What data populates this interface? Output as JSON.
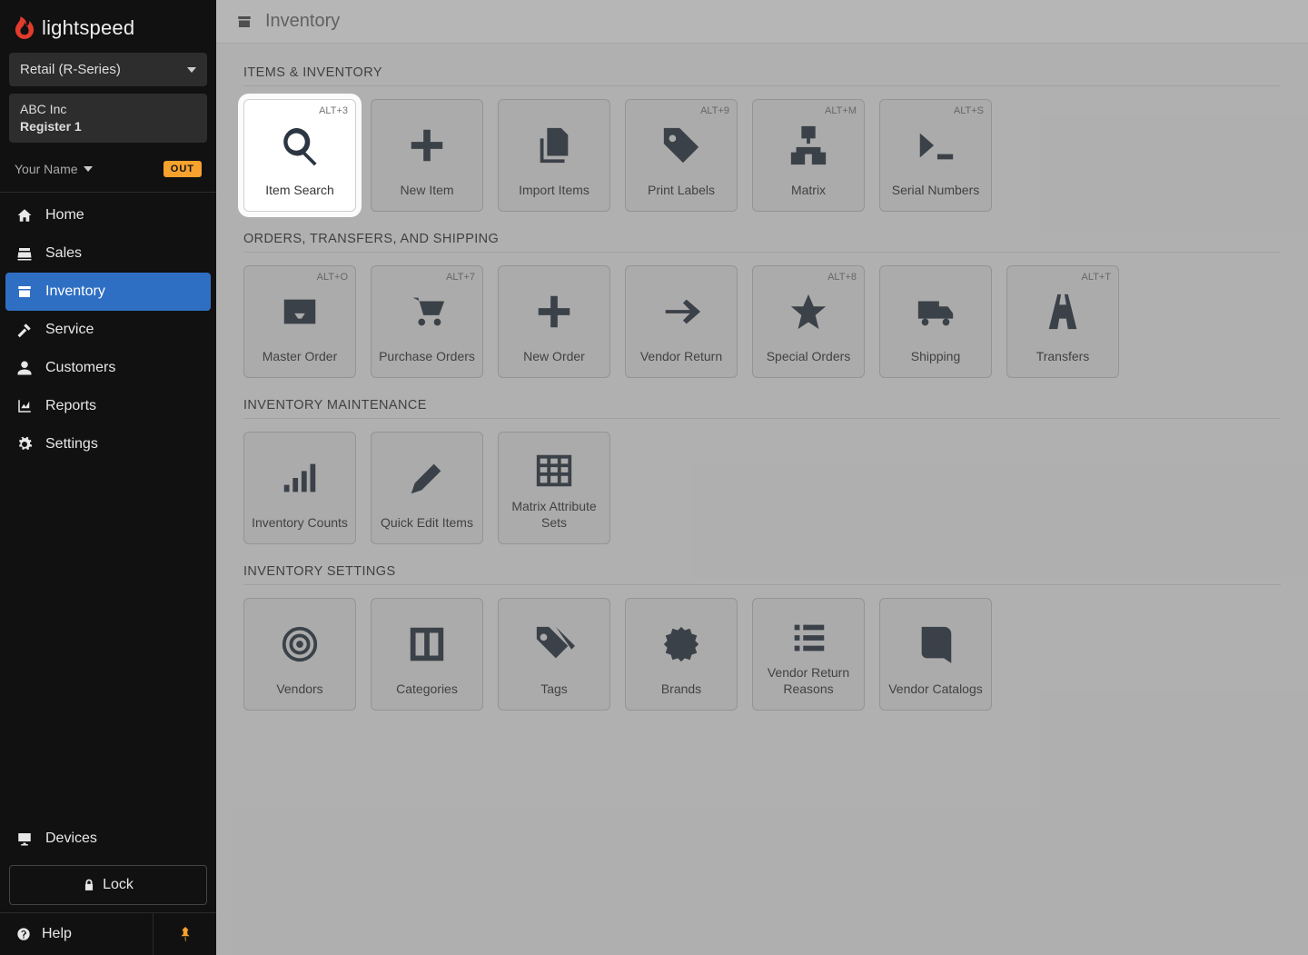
{
  "brand": "lightspeed",
  "selector": {
    "label": "Retail (R-Series)"
  },
  "store": {
    "name": "ABC Inc",
    "register": "Register 1"
  },
  "user": {
    "name": "Your Name",
    "badge": "OUT"
  },
  "nav": {
    "home": "Home",
    "sales": "Sales",
    "inventory": "Inventory",
    "service": "Service",
    "customers": "Customers",
    "reports": "Reports",
    "settings": "Settings",
    "devices": "Devices",
    "lock": "Lock",
    "help": "Help"
  },
  "page": {
    "title": "Inventory"
  },
  "sections": {
    "items": {
      "title": "ITEMS & INVENTORY",
      "cards": {
        "item_search": {
          "label": "Item Search",
          "shortcut": "ALT+3"
        },
        "new_item": {
          "label": "New Item",
          "shortcut": ""
        },
        "import_items": {
          "label": "Import Items",
          "shortcut": ""
        },
        "print_labels": {
          "label": "Print Labels",
          "shortcut": "ALT+9"
        },
        "matrix": {
          "label": "Matrix",
          "shortcut": "ALT+M"
        },
        "serial_numbers": {
          "label": "Serial Numbers",
          "shortcut": "ALT+S"
        }
      }
    },
    "orders": {
      "title": "ORDERS, TRANSFERS, AND SHIPPING",
      "cards": {
        "master_order": {
          "label": "Master Order",
          "shortcut": "ALT+O"
        },
        "purchase_orders": {
          "label": "Purchase Orders",
          "shortcut": "ALT+7"
        },
        "new_order": {
          "label": "New Order",
          "shortcut": ""
        },
        "vendor_return": {
          "label": "Vendor Return",
          "shortcut": ""
        },
        "special_orders": {
          "label": "Special Orders",
          "shortcut": "ALT+8"
        },
        "shipping": {
          "label": "Shipping",
          "shortcut": ""
        },
        "transfers": {
          "label": "Transfers",
          "shortcut": "ALT+T"
        }
      }
    },
    "maintenance": {
      "title": "INVENTORY MAINTENANCE",
      "cards": {
        "inventory_counts": {
          "label": "Inventory Counts"
        },
        "quick_edit": {
          "label": "Quick Edit Items"
        },
        "matrix_sets": {
          "label": "Matrix Attribute Sets"
        }
      }
    },
    "settings": {
      "title": "INVENTORY SETTINGS",
      "cards": {
        "vendors": {
          "label": "Vendors"
        },
        "categories": {
          "label": "Categories"
        },
        "tags": {
          "label": "Tags"
        },
        "brands": {
          "label": "Brands"
        },
        "vendor_return_reasons": {
          "label": "Vendor Return Reasons"
        },
        "vendor_catalogs": {
          "label": "Vendor Catalogs"
        }
      }
    }
  }
}
